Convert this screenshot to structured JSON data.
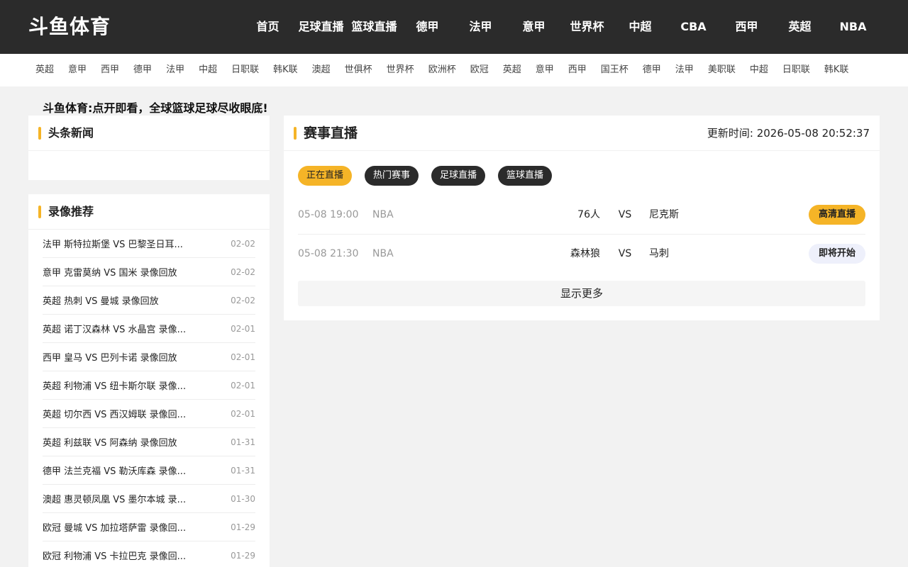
{
  "header": {
    "logo": "斗鱼体育",
    "nav": [
      "首页",
      "足球直播",
      "篮球直播",
      "德甲",
      "法甲",
      "意甲",
      "世界杯",
      "中超",
      "CBA",
      "西甲",
      "英超",
      "NBA"
    ]
  },
  "subnav": [
    "英超",
    "意甲",
    "西甲",
    "德甲",
    "法甲",
    "中超",
    "日职联",
    "韩K联",
    "澳超",
    "世俱杯",
    "世界杯",
    "欧洲杯",
    "欧冠",
    "英超",
    "意甲",
    "西甲",
    "国王杯",
    "德甲",
    "法甲",
    "美职联",
    "中超",
    "日职联",
    "韩K联"
  ],
  "slogan": "斗鱼体育:点开即看，全球篮球足球尽收眼底!",
  "news": {
    "title": "头条新闻"
  },
  "replay": {
    "title": "录像推荐",
    "items": [
      {
        "text": "法甲 斯特拉斯堡 VS 巴黎圣日耳...",
        "date": "02-02"
      },
      {
        "text": "意甲 克雷莫纳 VS 国米 录像回放",
        "date": "02-02"
      },
      {
        "text": "英超 热刺 VS 曼城 录像回放",
        "date": "02-02"
      },
      {
        "text": "英超 诺丁汉森林 VS 水晶宫 录像...",
        "date": "02-01"
      },
      {
        "text": "西甲 皇马 VS 巴列卡诺 录像回放",
        "date": "02-01"
      },
      {
        "text": "英超 利物浦 VS 纽卡斯尔联 录像...",
        "date": "02-01"
      },
      {
        "text": "英超 切尔西 VS 西汉姆联 录像回...",
        "date": "02-01"
      },
      {
        "text": "英超 利兹联 VS 阿森纳 录像回放",
        "date": "01-31"
      },
      {
        "text": "德甲 法兰克福 VS 勒沃库森 录像...",
        "date": "01-31"
      },
      {
        "text": "澳超 惠灵顿凤凰 VS 墨尔本城 录...",
        "date": "01-30"
      },
      {
        "text": "欧冠 曼城 VS 加拉塔萨雷 录像回...",
        "date": "01-29"
      },
      {
        "text": "欧冠 利物浦 VS 卡拉巴克 录像回...",
        "date": "01-29"
      }
    ]
  },
  "live": {
    "title": "赛事直播",
    "update_label": "更新时间:",
    "update_time": "2026-05-08 20:52:37",
    "tabs": [
      "正在直播",
      "热门赛事",
      "足球直播",
      "篮球直播"
    ],
    "matches": [
      {
        "time": "05-08 19:00",
        "league": "NBA",
        "home": "76人",
        "vs": "VS",
        "away": "尼克斯",
        "status": "高清直播"
      },
      {
        "time": "05-08 21:30",
        "league": "NBA",
        "home": "森林狼",
        "vs": "VS",
        "away": "马刺",
        "status": "即将开始"
      }
    ],
    "more": "显示更多"
  }
}
